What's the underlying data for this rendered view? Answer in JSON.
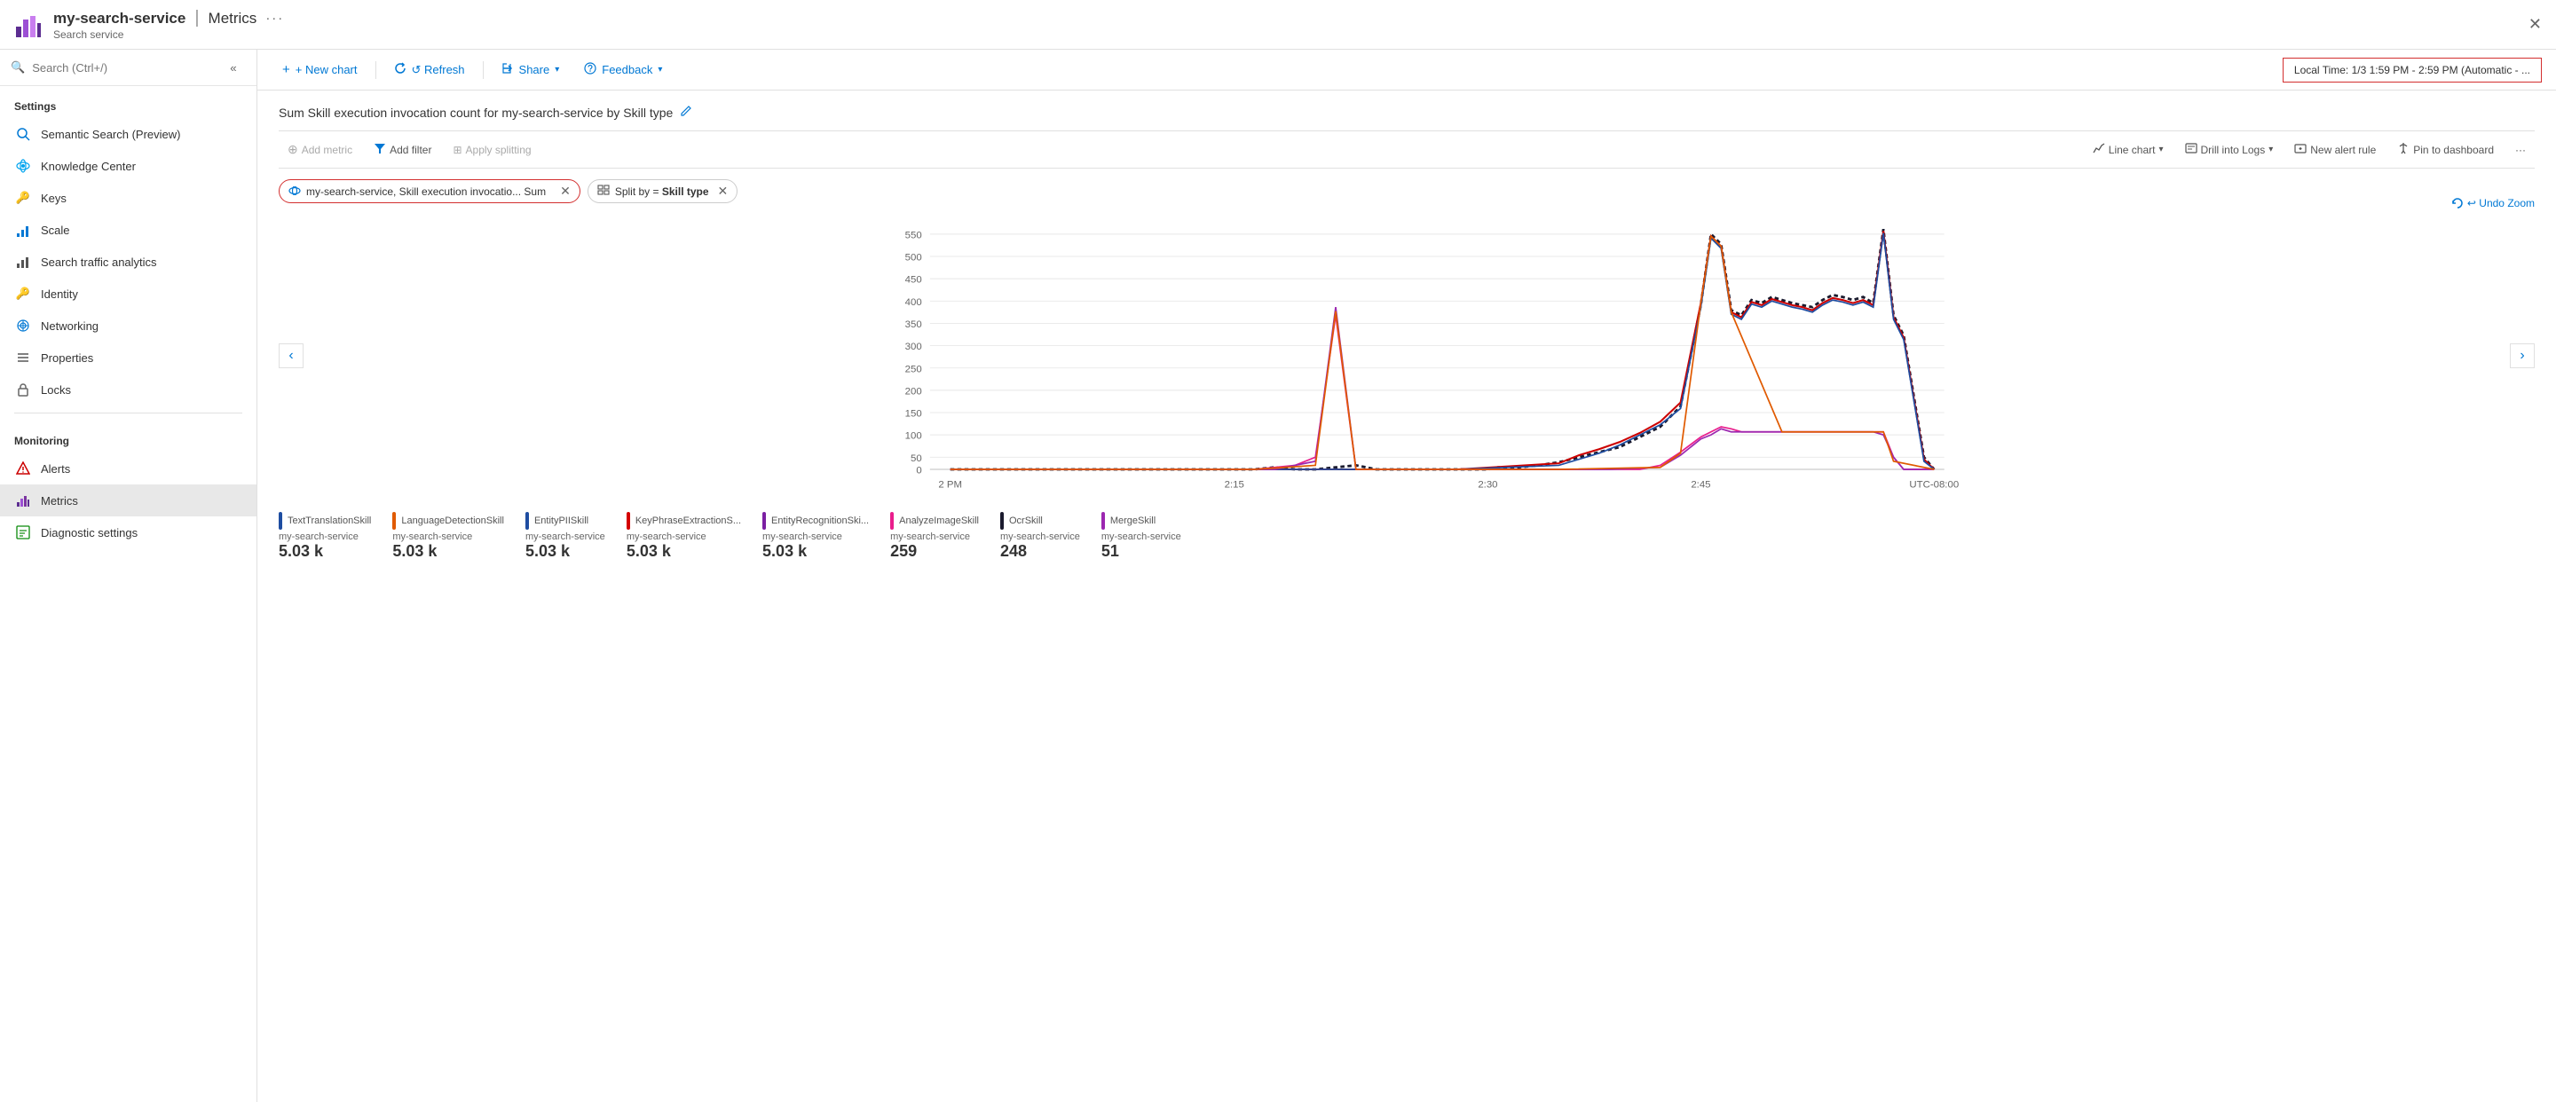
{
  "header": {
    "app_icon_color": "#5c2d91",
    "service_name": "my-search-service",
    "separator": "|",
    "page_title": "Metrics",
    "ellipsis": "···",
    "subtitle": "Search service",
    "close_label": "✕"
  },
  "sidebar": {
    "search_placeholder": "Search (Ctrl+/)",
    "sections": [
      {
        "label": "Settings",
        "items": [
          {
            "id": "semantic-search",
            "label": "Semantic Search (Preview)",
            "icon": "🔍",
            "icon_color": "#0078d4"
          },
          {
            "id": "knowledge-center",
            "label": "Knowledge Center",
            "icon": "☁",
            "icon_color": "#0098d4"
          },
          {
            "id": "keys",
            "label": "Keys",
            "icon": "🔑",
            "icon_color": "#ffd700"
          },
          {
            "id": "scale",
            "label": "Scale",
            "icon": "📐",
            "icon_color": "#0078d4"
          },
          {
            "id": "search-traffic",
            "label": "Search traffic analytics",
            "icon": "📊",
            "icon_color": "#333"
          },
          {
            "id": "identity",
            "label": "Identity",
            "icon": "🔑",
            "icon_color": "#ffd700"
          },
          {
            "id": "networking",
            "label": "Networking",
            "icon": "⚙",
            "icon_color": "#0078d4"
          },
          {
            "id": "properties",
            "label": "Properties",
            "icon": "≡",
            "icon_color": "#0078d4"
          },
          {
            "id": "locks",
            "label": "Locks",
            "icon": "🔒",
            "icon_color": "#666"
          }
        ]
      },
      {
        "label": "Monitoring",
        "items": [
          {
            "id": "alerts",
            "label": "Alerts",
            "icon": "🔔",
            "icon_color": "#c00"
          },
          {
            "id": "metrics",
            "label": "Metrics",
            "icon": "📈",
            "icon_color": "#5c2d91",
            "active": true
          },
          {
            "id": "diagnostic",
            "label": "Diagnostic settings",
            "icon": "📋",
            "icon_color": "#0a0"
          }
        ]
      }
    ]
  },
  "toolbar": {
    "new_chart_label": "+ New chart",
    "refresh_label": "↺ Refresh",
    "share_label": "Share",
    "feedback_label": "Feedback",
    "time_range_label": "Local Time: 1/3 1:59 PM - 2:59 PM (Automatic - ..."
  },
  "chart": {
    "title": "Sum Skill execution invocation count for my-search-service by Skill type",
    "add_metric_label": "Add metric",
    "add_filter_label": "Add filter",
    "apply_splitting_label": "Apply splitting",
    "line_chart_label": "Line chart",
    "drill_logs_label": "Drill into Logs",
    "new_alert_label": "New alert rule",
    "pin_dashboard_label": "Pin to dashboard",
    "more_label": "···",
    "undo_zoom_label": "↩ Undo Zoom",
    "metric_pill": {
      "icon": "☁",
      "label": "my-search-service, Skill execution invocatio... Sum",
      "close": "✕"
    },
    "split_pill": {
      "icon": "⊞",
      "label": "Split by = Skill type",
      "close": "✕"
    },
    "y_axis": [
      "550",
      "500",
      "450",
      "400",
      "350",
      "300",
      "250",
      "200",
      "150",
      "100",
      "50",
      "0"
    ],
    "x_axis": [
      "2 PM",
      "2:15",
      "2:30",
      "2:45",
      "UTC-08:00"
    ],
    "legend": [
      {
        "id": "text-translation",
        "label": "TextTranslationSkill",
        "service": "my-search-service",
        "value": "5.03 k",
        "color": "#1e4da1"
      },
      {
        "id": "language-detection",
        "label": "LanguageDetectionSkill",
        "service": "my-search-service",
        "value": "5.03 k",
        "color": "#e05a00"
      },
      {
        "id": "entity-pii",
        "label": "EntityPIISkill",
        "service": "my-search-service",
        "value": "5.03 k",
        "color": "#1e4da1"
      },
      {
        "id": "key-phrase",
        "label": "KeyPhraseExtractionS...",
        "service": "my-search-service",
        "value": "5.03 k",
        "color": "#d40000"
      },
      {
        "id": "entity-recognition",
        "label": "EntityRecognitionSki...",
        "service": "my-search-service",
        "value": "5.03 k",
        "color": "#7b1fa2"
      },
      {
        "id": "analyze-image",
        "label": "AnalyzeImageSkill",
        "service": "my-search-service",
        "value": "259",
        "color": "#e91e8c"
      },
      {
        "id": "ocr-skill",
        "label": "OcrSkill",
        "service": "my-search-service",
        "value": "248",
        "color": "#1a1a2e"
      },
      {
        "id": "merge-skill",
        "label": "MergeSkill",
        "service": "my-search-service",
        "value": "51",
        "color": "#9c27b0"
      }
    ]
  }
}
